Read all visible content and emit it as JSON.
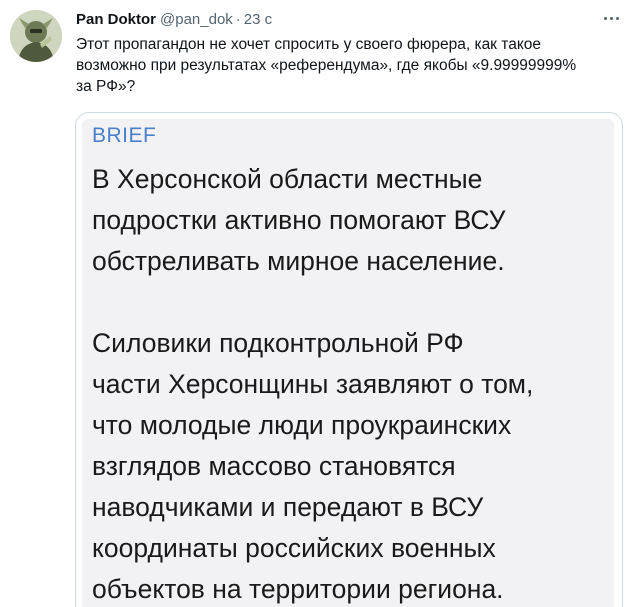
{
  "tweet": {
    "display_name": "Pan Doktor",
    "handle": "@pan_dok",
    "separator": "·",
    "time": "23 с",
    "text_lines": [
      "Этот пропагандон не хочет спросить у своего фюрера, как такое",
      "возможно при результатах «референдума», где якобы «9.99999999%",
      "за РФ»?"
    ]
  },
  "media": {
    "source_label": "BRIEF",
    "paragraph1": [
      "В Херсонской области местные",
      "подростки активно помогают ВСУ",
      "обстреливать мирное население."
    ],
    "paragraph2": [
      "Силовики подконтрольной РФ",
      "части Херсонщины заявляют о том,",
      "что молодые люди проукраинских",
      "взглядов массово становятся",
      "наводчиками и передают в ВСУ",
      "координаты российских военных",
      "объектов на территории региона."
    ]
  },
  "colors": {
    "brief_accent": "#4a7fc9",
    "secondary_text": "#536471",
    "card_border": "#cfd9de"
  },
  "icons": {
    "more": "more-horizontal-icon"
  }
}
